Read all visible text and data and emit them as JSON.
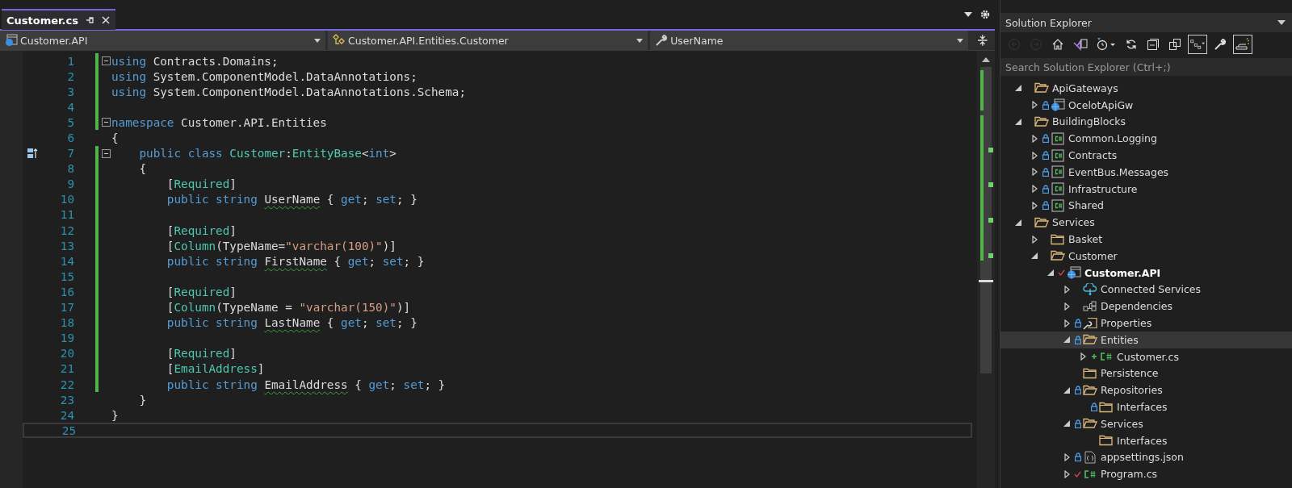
{
  "editor": {
    "tab": {
      "title": "Customer.cs",
      "selected": true
    },
    "nav": [
      {
        "kind": "project",
        "text": "Customer.API"
      },
      {
        "kind": "class",
        "text": "Customer.API.Entities.Customer"
      },
      {
        "kind": "property",
        "text": "UserName"
      }
    ],
    "lines": [
      {
        "number": "1",
        "changed": true,
        "fold": true,
        "tokens": [
          {
            "t": "using",
            "kind": "kw"
          },
          {
            "t": " Contracts.Domains;",
            "kind": "p"
          }
        ]
      },
      {
        "number": "2",
        "changed": true,
        "fold": false,
        "tokens": [
          {
            "t": "using",
            "kind": "kw"
          },
          {
            "t": " System.ComponentModel.DataAnnotations;",
            "kind": "p"
          }
        ]
      },
      {
        "number": "3",
        "changed": true,
        "fold": false,
        "tokens": [
          {
            "t": "using",
            "kind": "kw"
          },
          {
            "t": " System.ComponentModel.DataAnnotations.Schema;",
            "kind": "p"
          }
        ]
      },
      {
        "number": "4",
        "changed": true,
        "fold": false
      },
      {
        "number": "5",
        "changed": true,
        "fold": true,
        "tokens": [
          {
            "t": "namespace",
            "kind": "kw"
          },
          {
            "t": " Customer.API.Entities",
            "kind": "p"
          }
        ]
      },
      {
        "number": "6",
        "changed": false,
        "fold": false,
        "tokens": [
          {
            "t": "{",
            "kind": "p"
          }
        ]
      },
      {
        "number": "7",
        "changed": true,
        "fold": true,
        "margin_icon": true,
        "tokens": [
          {
            "t": "    public",
            "kind": "kw"
          },
          {
            "t": " class",
            "kind": "kw"
          },
          {
            "t": " Customer",
            "kind": "ty"
          },
          {
            "t": ":",
            "kind": "p"
          },
          {
            "t": "EntityBase",
            "kind": "ty"
          },
          {
            "t": "<",
            "kind": "p"
          },
          {
            "t": "int",
            "kind": "kw"
          },
          {
            "t": ">",
            "kind": "p"
          }
        ]
      },
      {
        "number": "8",
        "changed": true,
        "fold": false,
        "tokens": [
          {
            "t": "    {",
            "kind": "p"
          }
        ]
      },
      {
        "number": "9",
        "changed": true,
        "fold": false,
        "tokens": [
          {
            "t": "        [",
            "kind": "p"
          },
          {
            "t": "Required",
            "kind": "ty"
          },
          {
            "t": "]",
            "kind": "p"
          }
        ]
      },
      {
        "number": "10",
        "changed": true,
        "fold": false,
        "tokens": [
          {
            "t": "        public",
            "kind": "kw"
          },
          {
            "t": " string ",
            "kind": "kw"
          },
          {
            "t": "UserName",
            "kind": "warn"
          },
          {
            "t": " { ",
            "kind": "p"
          },
          {
            "t": "get",
            "kind": "kw"
          },
          {
            "t": "; ",
            "kind": "p"
          },
          {
            "t": "set",
            "kind": "kw"
          },
          {
            "t": "; }",
            "kind": "p"
          }
        ]
      },
      {
        "number": "11",
        "changed": true,
        "fold": false
      },
      {
        "number": "12",
        "changed": true,
        "fold": false,
        "tokens": [
          {
            "t": "        [",
            "kind": "p"
          },
          {
            "t": "Required",
            "kind": "ty"
          },
          {
            "t": "]",
            "kind": "p"
          }
        ]
      },
      {
        "number": "13",
        "changed": true,
        "fold": false,
        "tokens": [
          {
            "t": "        [",
            "kind": "p"
          },
          {
            "t": "Column",
            "kind": "ty"
          },
          {
            "t": "(TypeName=",
            "kind": "p"
          },
          {
            "t": "\"varchar(100)\"",
            "kind": "str"
          },
          {
            "t": ")]",
            "kind": "p"
          }
        ]
      },
      {
        "number": "14",
        "changed": true,
        "fold": false,
        "tokens": [
          {
            "t": "        public",
            "kind": "kw"
          },
          {
            "t": " string ",
            "kind": "kw"
          },
          {
            "t": "FirstName",
            "kind": "warn"
          },
          {
            "t": " { ",
            "kind": "p"
          },
          {
            "t": "get",
            "kind": "kw"
          },
          {
            "t": "; ",
            "kind": "p"
          },
          {
            "t": "set",
            "kind": "kw"
          },
          {
            "t": "; }",
            "kind": "p"
          }
        ]
      },
      {
        "number": "15",
        "changed": true,
        "fold": false
      },
      {
        "number": "16",
        "changed": true,
        "fold": false,
        "tokens": [
          {
            "t": "        [",
            "kind": "p"
          },
          {
            "t": "Required",
            "kind": "ty"
          },
          {
            "t": "]",
            "kind": "p"
          }
        ]
      },
      {
        "number": "17",
        "changed": true,
        "fold": false,
        "tokens": [
          {
            "t": "        [",
            "kind": "p"
          },
          {
            "t": "Column",
            "kind": "ty"
          },
          {
            "t": "(TypeName = ",
            "kind": "p"
          },
          {
            "t": "\"varchar(150)\"",
            "kind": "str"
          },
          {
            "t": ")]",
            "kind": "p"
          }
        ]
      },
      {
        "number": "18",
        "changed": true,
        "fold": false,
        "tokens": [
          {
            "t": "        public",
            "kind": "kw"
          },
          {
            "t": " string ",
            "kind": "kw"
          },
          {
            "t": "LastName",
            "kind": "warn"
          },
          {
            "t": " { ",
            "kind": "p"
          },
          {
            "t": "get",
            "kind": "kw"
          },
          {
            "t": "; ",
            "kind": "p"
          },
          {
            "t": "set",
            "kind": "kw"
          },
          {
            "t": "; }",
            "kind": "p"
          }
        ]
      },
      {
        "number": "19",
        "changed": true,
        "fold": false
      },
      {
        "number": "20",
        "changed": true,
        "fold": false,
        "tokens": [
          {
            "t": "        [",
            "kind": "p"
          },
          {
            "t": "Required",
            "kind": "ty"
          },
          {
            "t": "]",
            "kind": "p"
          }
        ]
      },
      {
        "number": "21",
        "changed": true,
        "fold": false,
        "tokens": [
          {
            "t": "        [",
            "kind": "p"
          },
          {
            "t": "EmailAddress",
            "kind": "ty"
          },
          {
            "t": "]",
            "kind": "p"
          }
        ]
      },
      {
        "number": "22",
        "changed": true,
        "fold": false,
        "tokens": [
          {
            "t": "        public",
            "kind": "kw"
          },
          {
            "t": " string ",
            "kind": "kw"
          },
          {
            "t": "EmailAddress",
            "kind": "warn"
          },
          {
            "t": " { ",
            "kind": "p"
          },
          {
            "t": "get",
            "kind": "kw"
          },
          {
            "t": "; ",
            "kind": "p"
          },
          {
            "t": "set",
            "kind": "kw"
          },
          {
            "t": "; }",
            "kind": "p"
          }
        ]
      },
      {
        "number": "23",
        "changed": false,
        "fold": false,
        "tokens": [
          {
            "t": "    }",
            "kind": "p"
          }
        ]
      },
      {
        "number": "24",
        "changed": false,
        "fold": false,
        "tokens": [
          {
            "t": "}",
            "kind": "p"
          }
        ]
      },
      {
        "number": "25",
        "changed": false,
        "fold": false,
        "current": true
      }
    ]
  },
  "solution_explorer": {
    "title": "Solution Explorer",
    "search": {
      "placeholder": "Search Solution Explorer (Ctrl+;)"
    },
    "toolbar": [
      {
        "kind": "back",
        "disabled": true
      },
      {
        "kind": "forward",
        "disabled": true
      },
      {
        "kind": "home",
        "disabled": false
      },
      {
        "kind": "switch-views",
        "disabled": false
      },
      {
        "kind": "pending-changes",
        "disabled": false
      },
      {
        "kind": "sync",
        "disabled": false
      },
      {
        "kind": "collapse",
        "disabled": false
      },
      {
        "kind": "copy",
        "disabled": false
      },
      {
        "kind": "show-all",
        "disabled": false,
        "pressed": true
      },
      {
        "kind": "properties",
        "disabled": false
      },
      {
        "kind": "preview",
        "disabled": false,
        "pressed": true
      }
    ],
    "tree": [
      {
        "label": "ApiGateways",
        "kind": "folder",
        "expanded": true,
        "locked": false,
        "checked": false,
        "added": false,
        "selected": false,
        "startup": false,
        "children": [
          {
            "label": "OcelotApiGw",
            "kind": "web-project",
            "expanded": false,
            "locked": true,
            "checked": false,
            "added": false,
            "selected": false,
            "startup": false
          }
        ]
      },
      {
        "label": "BuildingBlocks",
        "kind": "folder",
        "expanded": true,
        "locked": false,
        "checked": false,
        "added": false,
        "selected": false,
        "startup": false,
        "children": [
          {
            "label": "Common.Logging",
            "kind": "library",
            "expanded": false,
            "locked": true,
            "checked": false,
            "added": false,
            "selected": false,
            "startup": false
          },
          {
            "label": "Contracts",
            "kind": "library",
            "expanded": false,
            "locked": true,
            "checked": false,
            "added": false,
            "selected": false,
            "startup": false
          },
          {
            "label": "EventBus.Messages",
            "kind": "library",
            "expanded": false,
            "locked": true,
            "checked": false,
            "added": false,
            "selected": false,
            "startup": false
          },
          {
            "label": "Infrastructure",
            "kind": "library",
            "expanded": false,
            "locked": true,
            "checked": false,
            "added": false,
            "selected": false,
            "startup": false
          },
          {
            "label": "Shared",
            "kind": "library",
            "expanded": false,
            "locked": true,
            "checked": false,
            "added": false,
            "selected": false,
            "startup": false
          }
        ]
      },
      {
        "label": "Services",
        "kind": "folder",
        "expanded": true,
        "locked": false,
        "checked": false,
        "added": false,
        "selected": false,
        "startup": false,
        "children": [
          {
            "label": "Basket",
            "kind": "folder",
            "expanded": false,
            "locked": false,
            "checked": false,
            "added": false,
            "selected": false,
            "startup": false
          },
          {
            "label": "Customer",
            "kind": "folder",
            "expanded": true,
            "locked": false,
            "checked": false,
            "added": false,
            "selected": false,
            "startup": false,
            "children": [
              {
                "label": "Customer.API",
                "kind": "web-project",
                "expanded": true,
                "locked": false,
                "checked": true,
                "added": false,
                "selected": false,
                "startup": true,
                "children": [
                  {
                    "label": "Connected Services",
                    "kind": "cloud",
                    "expanded": false,
                    "locked": false,
                    "checked": false,
                    "added": false,
                    "selected": false,
                    "startup": false
                  },
                  {
                    "label": "Dependencies",
                    "kind": "dependencies",
                    "expanded": false,
                    "locked": false,
                    "checked": false,
                    "added": false,
                    "selected": false,
                    "startup": false
                  },
                  {
                    "label": "Properties",
                    "kind": "properties",
                    "expanded": false,
                    "locked": true,
                    "checked": false,
                    "added": false,
                    "selected": false,
                    "startup": false
                  },
                  {
                    "label": "Entities",
                    "kind": "folder",
                    "expanded": true,
                    "locked": true,
                    "checked": false,
                    "added": false,
                    "selected": true,
                    "startup": false,
                    "children": [
                      {
                        "label": "Customer.cs",
                        "kind": "source",
                        "expanded": false,
                        "locked": false,
                        "checked": false,
                        "added": true,
                        "selected": false,
                        "startup": false
                      }
                    ]
                  },
                  {
                    "label": "Persistence",
                    "kind": "folder",
                    "locked": false,
                    "checked": false,
                    "added": false,
                    "selected": false,
                    "startup": false
                  },
                  {
                    "label": "Repositories",
                    "kind": "folder",
                    "expanded": true,
                    "locked": true,
                    "checked": false,
                    "added": false,
                    "selected": false,
                    "startup": false,
                    "children": [
                      {
                        "label": "Interfaces",
                        "kind": "folder",
                        "locked": true,
                        "checked": false,
                        "added": false,
                        "selected": false,
                        "startup": false
                      }
                    ]
                  },
                  {
                    "label": "Services",
                    "kind": "folder",
                    "expanded": true,
                    "locked": true,
                    "checked": false,
                    "added": false,
                    "selected": false,
                    "startup": false,
                    "children": [
                      {
                        "label": "Interfaces",
                        "kind": "folder",
                        "locked": false,
                        "checked": false,
                        "added": false,
                        "selected": false,
                        "startup": false
                      }
                    ]
                  },
                  {
                    "label": "appsettings.json",
                    "kind": "json",
                    "expanded": false,
                    "locked": true,
                    "checked": false,
                    "added": false,
                    "selected": false,
                    "startup": false
                  },
                  {
                    "label": "Program.cs",
                    "kind": "source",
                    "expanded": false,
                    "locked": false,
                    "checked": true,
                    "added": false,
                    "selected": false,
                    "startup": false
                  }
                ]
              }
            ]
          }
        ]
      }
    ]
  }
}
